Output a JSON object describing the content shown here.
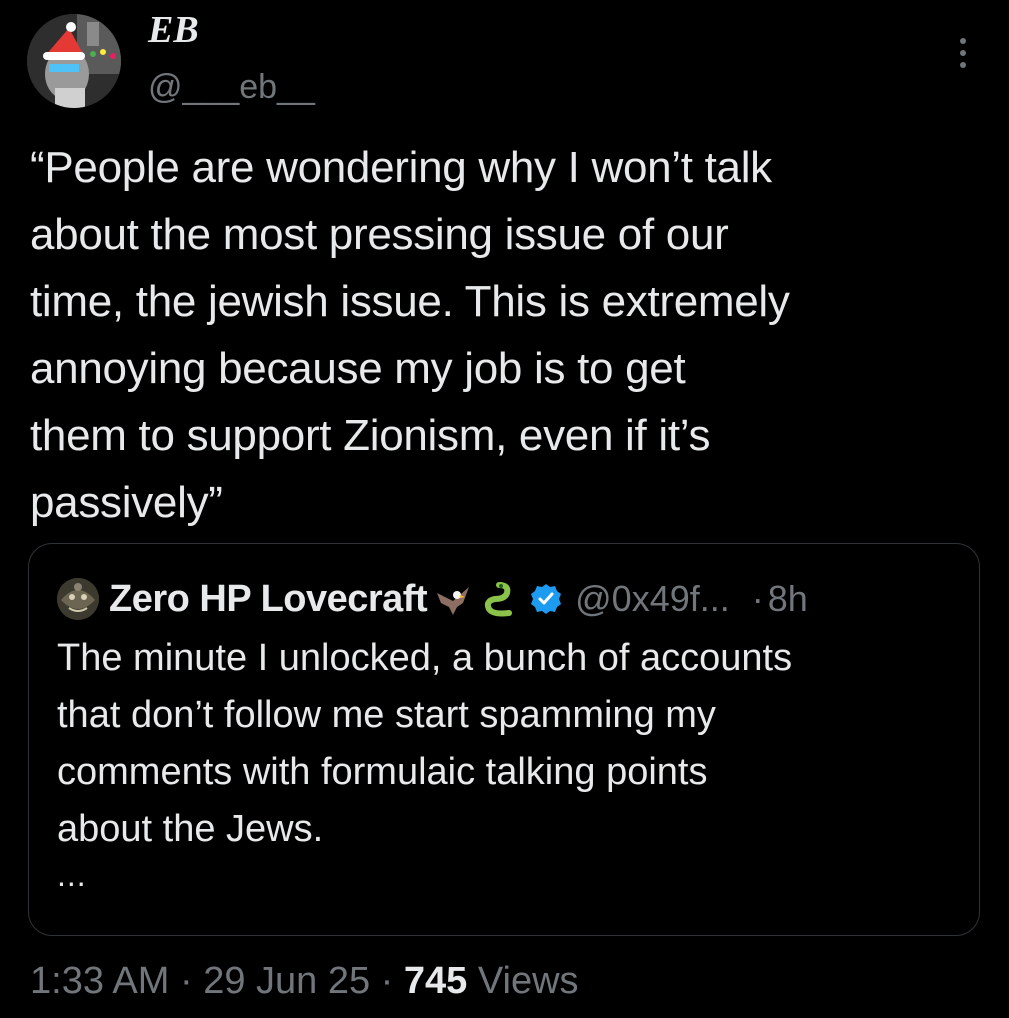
{
  "author": {
    "display_name": "EB",
    "handle": "@___eb__"
  },
  "tweet": {
    "text": "“People are wondering why I won’t talk\nabout the most pressing issue of our\ntime, the jewish issue. This is extremely\nannoying because my job is to get\nthem to support Zionism, even if it’s\npassively”"
  },
  "quoted_tweet": {
    "display_name": "Zero HP Lovecraft",
    "emoji_icons": [
      "eagle-icon",
      "snake-icon"
    ],
    "verified": true,
    "handle": "@0x49f...",
    "dot": "·",
    "time": "8h",
    "text": "The minute I unlocked, a bunch of accounts\nthat don’t follow me start spamming my\ncomments with formulaic talking points\nabout the Jews.",
    "ellipsis": "..."
  },
  "meta": {
    "time": "1:33 AM",
    "sep1": " · ",
    "date": "29 Jun 25",
    "sep2": " · ",
    "views_count": "745",
    "views_label": " Views"
  },
  "colors": {
    "background": "#000000",
    "text_primary": "#e7e9ea",
    "text_secondary": "#71767b",
    "border": "#2f3336",
    "verified_blue": "#1d9bf0"
  }
}
